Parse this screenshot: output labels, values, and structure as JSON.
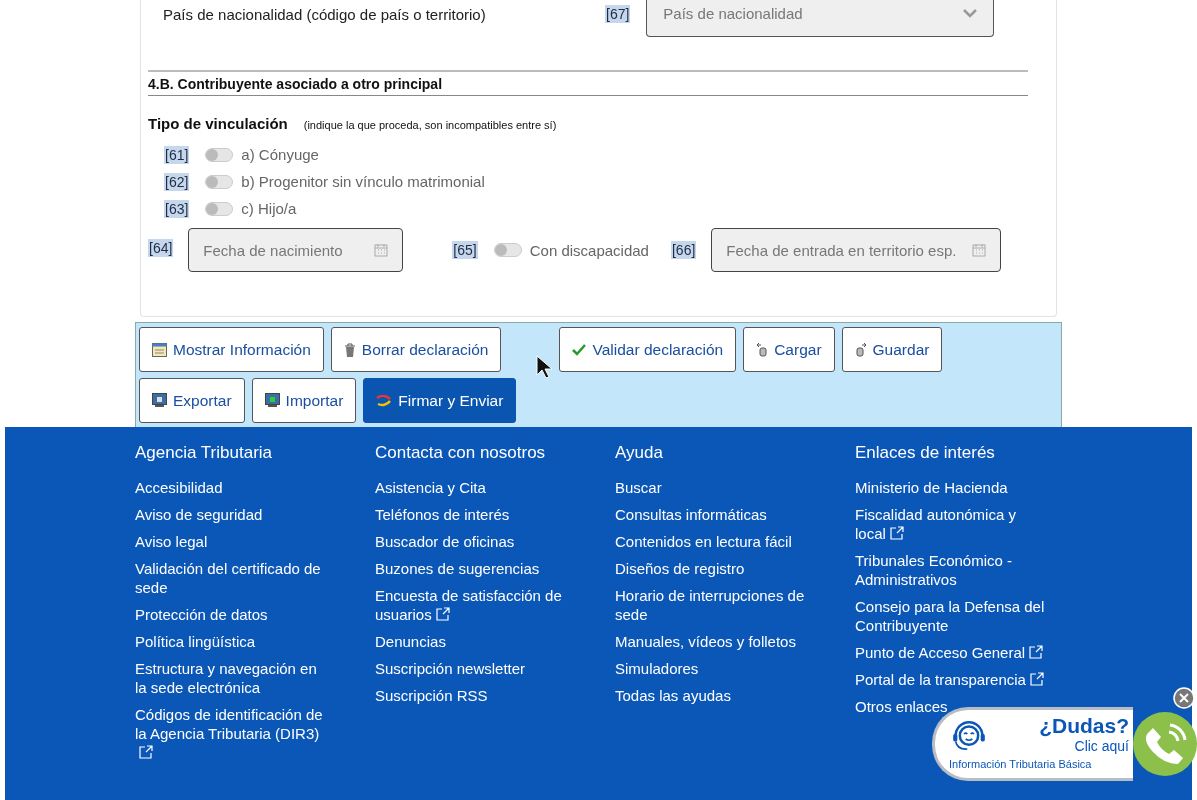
{
  "nationality": {
    "label": "País de nacionalidad (código de país o territorio)",
    "code": "[67]",
    "placeholder": "País de nacionalidad"
  },
  "section": {
    "title": "4.B. Contribuyente asociado a otro principal",
    "subtitle": "Tipo de vinculación",
    "hint": "(indique la que proceda, son incompatibles entre sí)"
  },
  "options": [
    {
      "code": "[61]",
      "label": "a) Cónyuge",
      "on": false
    },
    {
      "code": "[62]",
      "label": "b) Progenitor sin vínculo matrimonial",
      "on": false
    },
    {
      "code": "[63]",
      "label": "c) Hijo/a",
      "on": false
    }
  ],
  "birth": {
    "code": "[64]",
    "placeholder": "Fecha de nacimiento"
  },
  "disability": {
    "code": "[65]",
    "label": "Con discapacidad",
    "on": false
  },
  "entry": {
    "code": "[66]",
    "placeholder": "Fecha de entrada en territorio esp."
  },
  "buttons": [
    [
      {
        "label": "Mostrar Información",
        "kind": "normal"
      },
      {
        "label": "Borrar declaración",
        "kind": "normal"
      },
      {
        "label": "Validar declaración",
        "kind": "normal"
      },
      {
        "label": "Cargar",
        "kind": "normal"
      },
      {
        "label": "Guardar",
        "kind": "normal"
      }
    ],
    [
      {
        "label": "Exportar",
        "kind": "normal"
      },
      {
        "label": "Importar",
        "kind": "normal"
      },
      {
        "label": "Firmar y Enviar",
        "kind": "primary"
      }
    ]
  ],
  "footer": {
    "columns": [
      {
        "title": "Agencia Tributaria",
        "links": [
          {
            "label": "Accesibilidad",
            "external": false
          },
          {
            "label": "Aviso de seguridad",
            "external": false
          },
          {
            "label": "Aviso legal",
            "external": false
          },
          {
            "label": "Validación del certificado de sede",
            "external": false
          },
          {
            "label": "Protección de datos",
            "external": false
          },
          {
            "label": "Política lingüística",
            "external": false
          },
          {
            "label": "Estructura y navegación en la sede electrónica",
            "external": false
          },
          {
            "label": "Códigos de identificación de la Agencia Tributaria (DIR3)",
            "external": true
          }
        ]
      },
      {
        "title": "Contacta con nosotros",
        "links": [
          {
            "label": "Asistencia y Cita",
            "external": false
          },
          {
            "label": "Teléfonos de interés",
            "external": false
          },
          {
            "label": "Buscador de oficinas",
            "external": false
          },
          {
            "label": "Buzones de sugerencias",
            "external": false
          },
          {
            "label": "Encuesta de satisfacción de usuarios",
            "external": true
          },
          {
            "label": "Denuncias",
            "external": false
          },
          {
            "label": "Suscripción newsletter",
            "external": false
          },
          {
            "label": "Suscripción RSS",
            "external": false
          }
        ]
      },
      {
        "title": "Ayuda",
        "links": [
          {
            "label": "Buscar",
            "external": false
          },
          {
            "label": "Consultas informáticas",
            "external": false
          },
          {
            "label": "Contenidos en lectura fácil",
            "external": false
          },
          {
            "label": "Diseños de registro",
            "external": false
          },
          {
            "label": "Horario de interrupciones de sede",
            "external": false
          },
          {
            "label": "Manuales, vídeos y folletos",
            "external": false
          },
          {
            "label": "Simuladores",
            "external": false
          },
          {
            "label": "Todas las ayudas",
            "external": false
          }
        ]
      },
      {
        "title": "Enlaces de interés",
        "links": [
          {
            "label": "Ministerio de Hacienda",
            "external": false
          },
          {
            "label": "Fiscalidad autonómica y local",
            "external": true
          },
          {
            "label": "Tribunales Económico - Administrativos",
            "external": false
          },
          {
            "label": "Consejo para la Defensa del Contribuyente",
            "external": false
          },
          {
            "label": "Punto de Acceso General",
            "external": true
          },
          {
            "label": "Portal de la transparencia",
            "external": true
          },
          {
            "label": "Otros enlaces",
            "external": false
          }
        ]
      }
    ]
  },
  "help_widget": {
    "title": "¿Dudas?",
    "action": "Clic aquí",
    "caption": "Información Tributaria Básica"
  }
}
